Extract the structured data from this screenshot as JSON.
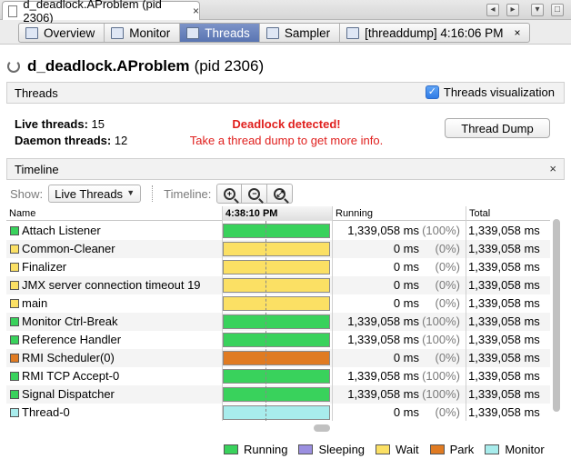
{
  "window": {
    "tab_title": "d_deadlock.AProblem (pid 2306)",
    "tab_close": "×",
    "controls": [
      "◂",
      "▸",
      "▾",
      "□"
    ]
  },
  "subtabs": [
    {
      "label": "Overview",
      "icon": "overview-icon",
      "active": false
    },
    {
      "label": "Monitor",
      "icon": "monitor-icon",
      "active": false
    },
    {
      "label": "Threads",
      "icon": "threads-icon",
      "active": true
    },
    {
      "label": "Sampler",
      "icon": "sampler-icon",
      "active": false
    },
    {
      "label": "[threaddump] 4:16:06 PM",
      "icon": "threaddump-icon",
      "active": false,
      "closable": true
    }
  ],
  "header": {
    "app_name": "d_deadlock.AProblem",
    "pid": "(pid 2306)"
  },
  "threads_section": {
    "title": "Threads",
    "visualization_label": "Threads visualization",
    "visualization_checked": true,
    "live_label": "Live threads:",
    "live_value": "15",
    "daemon_label": "Daemon threads:",
    "daemon_value": "12",
    "deadlock_title": "Deadlock detected!",
    "deadlock_hint": "Take a thread dump to get more info.",
    "dump_button": "Thread Dump"
  },
  "timeline_section": {
    "title": "Timeline",
    "close": "×",
    "show_label": "Show:",
    "show_value": "Live Threads",
    "timeline_label": "Timeline:",
    "zoom_buttons": [
      "+",
      "−",
      "⤢"
    ]
  },
  "table": {
    "headers": {
      "name": "Name",
      "timeline": "4:38:10 PM",
      "running": "Running",
      "total": "Total"
    },
    "rows": [
      {
        "name": "Attach Listener",
        "state": "Running",
        "running": "1,339,058 ms",
        "pct": "(100%)",
        "total": "1,339,058 ms"
      },
      {
        "name": "Common-Cleaner",
        "state": "Wait",
        "running": "0 ms",
        "pct": "(0%)",
        "total": "1,339,058 ms"
      },
      {
        "name": "Finalizer",
        "state": "Wait",
        "running": "0 ms",
        "pct": "(0%)",
        "total": "1,339,058 ms"
      },
      {
        "name": "JMX server connection timeout 19",
        "state": "Wait",
        "running": "0 ms",
        "pct": "(0%)",
        "total": "1,339,058 ms"
      },
      {
        "name": "main",
        "state": "Wait",
        "running": "0 ms",
        "pct": "(0%)",
        "total": "1,339,058 ms"
      },
      {
        "name": "Monitor Ctrl-Break",
        "state": "Running",
        "running": "1,339,058 ms",
        "pct": "(100%)",
        "total": "1,339,058 ms"
      },
      {
        "name": "Reference Handler",
        "state": "Running",
        "running": "1,339,058 ms",
        "pct": "(100%)",
        "total": "1,339,058 ms"
      },
      {
        "name": "RMI Scheduler(0)",
        "state": "Park",
        "running": "0 ms",
        "pct": "(0%)",
        "total": "1,339,058 ms"
      },
      {
        "name": "RMI TCP Accept-0",
        "state": "Running",
        "running": "1,339,058 ms",
        "pct": "(100%)",
        "total": "1,339,058 ms"
      },
      {
        "name": "Signal Dispatcher",
        "state": "Running",
        "running": "1,339,058 ms",
        "pct": "(100%)",
        "total": "1,339,058 ms"
      },
      {
        "name": "Thread-0",
        "state": "Monitor",
        "running": "0 ms",
        "pct": "(0%)",
        "total": "1,339,058 ms"
      }
    ]
  },
  "legend": [
    {
      "label": "Running",
      "color": "#39d25c"
    },
    {
      "label": "Sleeping",
      "color": "#9b8fe0"
    },
    {
      "label": "Wait",
      "color": "#fbe064"
    },
    {
      "label": "Park",
      "color": "#e07b22"
    },
    {
      "label": "Monitor",
      "color": "#a8ecec"
    }
  ]
}
